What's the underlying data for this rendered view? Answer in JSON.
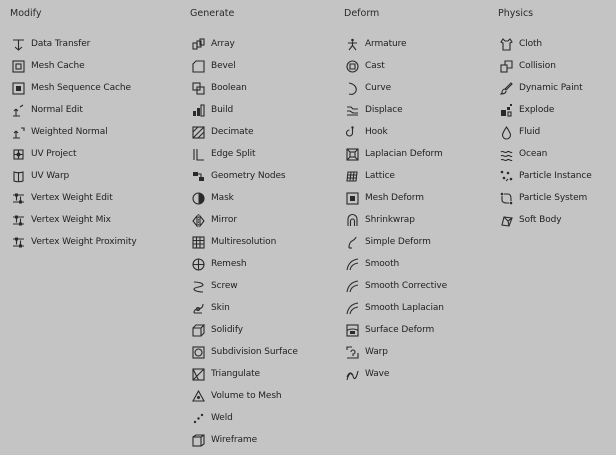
{
  "columns": [
    {
      "id": "modify",
      "header": "Modify",
      "items": [
        {
          "label": "Data Transfer",
          "icon": "data-transfer-icon"
        },
        {
          "label": "Mesh Cache",
          "icon": "mesh-cache-icon"
        },
        {
          "label": "Mesh Sequence Cache",
          "icon": "mesh-sequence-cache-icon"
        },
        {
          "label": "Normal Edit",
          "icon": "normal-edit-icon"
        },
        {
          "label": "Weighted Normal",
          "icon": "weighted-normal-icon"
        },
        {
          "label": "UV Project",
          "icon": "uv-project-icon"
        },
        {
          "label": "UV Warp",
          "icon": "uv-warp-icon"
        },
        {
          "label": "Vertex Weight Edit",
          "icon": "vertex-weight-icon"
        },
        {
          "label": "Vertex Weight Mix",
          "icon": "vertex-weight-icon"
        },
        {
          "label": "Vertex Weight Proximity",
          "icon": "vertex-weight-icon"
        }
      ]
    },
    {
      "id": "generate",
      "header": "Generate",
      "items": [
        {
          "label": "Array",
          "icon": "array-icon"
        },
        {
          "label": "Bevel",
          "icon": "bevel-icon"
        },
        {
          "label": "Boolean",
          "icon": "boolean-icon"
        },
        {
          "label": "Build",
          "icon": "build-icon"
        },
        {
          "label": "Decimate",
          "icon": "decimate-icon"
        },
        {
          "label": "Edge Split",
          "icon": "edge-split-icon"
        },
        {
          "label": "Geometry Nodes",
          "icon": "geometry-nodes-icon"
        },
        {
          "label": "Mask",
          "icon": "mask-icon"
        },
        {
          "label": "Mirror",
          "icon": "mirror-icon"
        },
        {
          "label": "Multiresolution",
          "icon": "multiresolution-icon"
        },
        {
          "label": "Remesh",
          "icon": "remesh-icon"
        },
        {
          "label": "Screw",
          "icon": "screw-icon"
        },
        {
          "label": "Skin",
          "icon": "skin-icon"
        },
        {
          "label": "Solidify",
          "icon": "solidify-icon"
        },
        {
          "label": "Subdivision Surface",
          "icon": "subdivision-surface-icon"
        },
        {
          "label": "Triangulate",
          "icon": "triangulate-icon"
        },
        {
          "label": "Volume to Mesh",
          "icon": "volume-to-mesh-icon"
        },
        {
          "label": "Weld",
          "icon": "weld-icon"
        },
        {
          "label": "Wireframe",
          "icon": "wireframe-icon"
        }
      ]
    },
    {
      "id": "deform",
      "header": "Deform",
      "items": [
        {
          "label": "Armature",
          "icon": "armature-icon"
        },
        {
          "label": "Cast",
          "icon": "cast-icon"
        },
        {
          "label": "Curve",
          "icon": "curve-icon"
        },
        {
          "label": "Displace",
          "icon": "displace-icon"
        },
        {
          "label": "Hook",
          "icon": "hook-icon"
        },
        {
          "label": "Laplacian Deform",
          "icon": "laplacian-deform-icon"
        },
        {
          "label": "Lattice",
          "icon": "lattice-icon"
        },
        {
          "label": "Mesh Deform",
          "icon": "mesh-deform-icon"
        },
        {
          "label": "Shrinkwrap",
          "icon": "shrinkwrap-icon"
        },
        {
          "label": "Simple Deform",
          "icon": "simple-deform-icon"
        },
        {
          "label": "Smooth",
          "icon": "smooth-icon"
        },
        {
          "label": "Smooth Corrective",
          "icon": "smooth-icon"
        },
        {
          "label": "Smooth Laplacian",
          "icon": "smooth-icon"
        },
        {
          "label": "Surface Deform",
          "icon": "surface-deform-icon"
        },
        {
          "label": "Warp",
          "icon": "warp-icon"
        },
        {
          "label": "Wave",
          "icon": "wave-icon"
        }
      ]
    },
    {
      "id": "physics",
      "header": "Physics",
      "items": [
        {
          "label": "Cloth",
          "icon": "cloth-icon"
        },
        {
          "label": "Collision",
          "icon": "collision-icon"
        },
        {
          "label": "Dynamic Paint",
          "icon": "dynamic-paint-icon"
        },
        {
          "label": "Explode",
          "icon": "explode-icon"
        },
        {
          "label": "Fluid",
          "icon": "fluid-icon"
        },
        {
          "label": "Ocean",
          "icon": "ocean-icon"
        },
        {
          "label": "Particle Instance",
          "icon": "particle-instance-icon"
        },
        {
          "label": "Particle System",
          "icon": "particle-system-icon"
        },
        {
          "label": "Soft Body",
          "icon": "soft-body-icon"
        }
      ]
    }
  ]
}
